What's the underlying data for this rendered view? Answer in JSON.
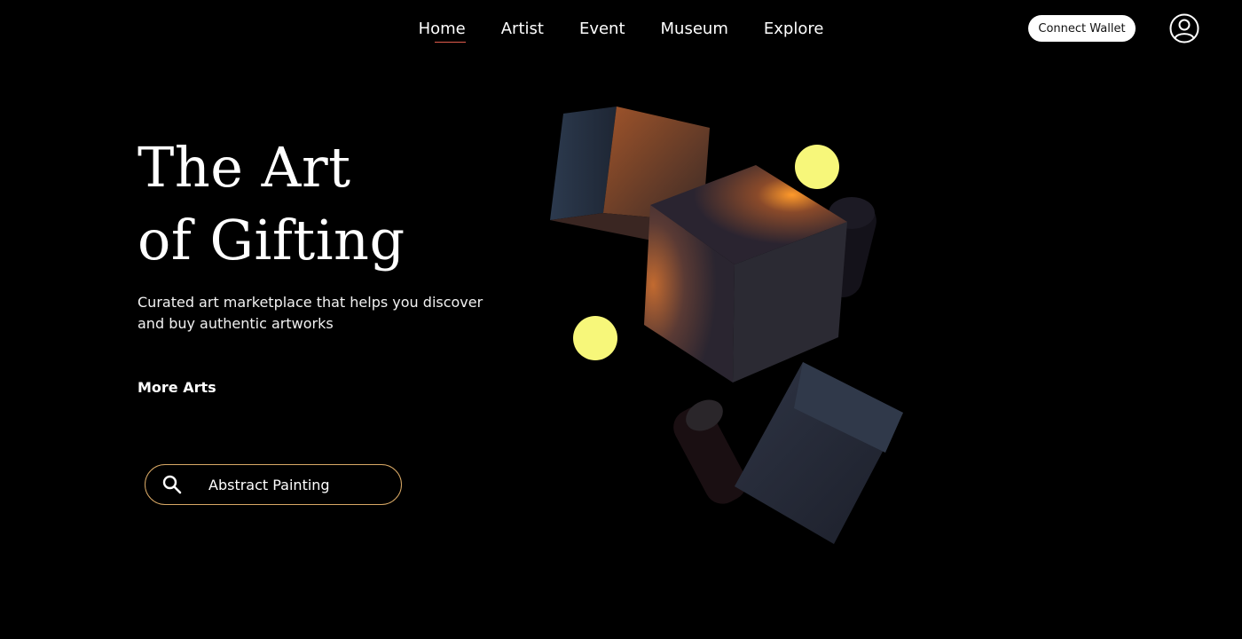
{
  "nav": {
    "items": [
      {
        "label": "Home",
        "active": true
      },
      {
        "label": "Artist"
      },
      {
        "label": "Event"
      },
      {
        "label": "Museum"
      },
      {
        "label": "Explore"
      }
    ]
  },
  "header": {
    "connect_wallet_label": "Connect Wallet",
    "user_icon": "user-circle-icon"
  },
  "hero": {
    "title_line1": "The Art",
    "title_line2": "of Gifting",
    "description": "Curated art marketplace that helps you discover and buy authentic artworks",
    "more_link": "More Arts"
  },
  "search": {
    "value": "Abstract Painting",
    "icon": "search-icon"
  },
  "colors": {
    "background": "#000000",
    "text": "#ffffff",
    "accent_underline": "#e25b4c",
    "search_border": "#d8a865",
    "orb": "#f7f77a"
  }
}
